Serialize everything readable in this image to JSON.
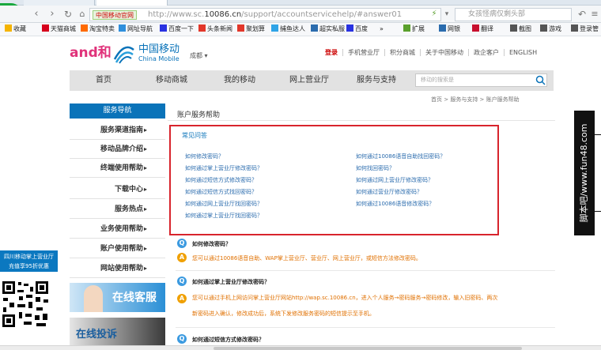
{
  "browser": {
    "site_badge": "中国移动官网",
    "url_host_prefix": "http://www.sc.",
    "url_host_main": "10086.cn",
    "url_path": "/support/accountservicehelp/#answer01",
    "search_text": "女孩怪病仅剩头部",
    "bookmarks": [
      {
        "label": "收藏",
        "icon": "star-icon",
        "color": "#f5b400"
      },
      {
        "label": "天猫商城",
        "icon": "tmall-icon",
        "color": "#d6001c"
      },
      {
        "label": "淘宝特卖",
        "icon": "taobao-icon",
        "color": "#ff6a00"
      },
      {
        "label": "网址导航",
        "icon": "nav-icon",
        "color": "#2f8fdc"
      },
      {
        "label": "百度一下",
        "icon": "baidu-icon",
        "color": "#2932e1"
      },
      {
        "label": "头条新闻",
        "icon": "news-icon",
        "color": "#e2372a"
      },
      {
        "label": "聚划算",
        "icon": "juhuasuan-icon",
        "color": "#e2372a"
      },
      {
        "label": "捕鱼达人",
        "icon": "fish-icon",
        "color": "#2fa4e7"
      },
      {
        "label": "超实私服",
        "icon": "game-icon",
        "color": "#2b6cae"
      },
      {
        "label": "百度",
        "icon": "baidu-icon",
        "color": "#2932e1"
      },
      {
        "label": "扩展",
        "icon": "extension-icon",
        "color": "#5aa02c"
      },
      {
        "label": "网银",
        "icon": "bank-icon",
        "color": "#2b6cae"
      },
      {
        "label": "翻译",
        "icon": "translate-icon",
        "color": "#c8102e"
      },
      {
        "label": "截图",
        "icon": "scissors-icon",
        "color": "#555555"
      },
      {
        "label": "游戏",
        "icon": "gamepad-icon",
        "color": "#555555"
      },
      {
        "label": "登录管",
        "icon": "user-icon",
        "color": "#555555"
      }
    ],
    "bookmark_more": "»"
  },
  "header": {
    "and_logo": "and和",
    "brand_cn": "中国移动",
    "brand_en": "China Mobile",
    "city": "成都",
    "top_links": [
      "登录",
      "手机营业厅",
      "积分商城",
      "关于中国移动",
      "政企客户",
      "ENGLISH"
    ]
  },
  "nav": {
    "items": [
      "首页",
      "移动商城",
      "我的移动",
      "网上营业厅",
      "服务与支持"
    ],
    "search_placeholder": "移动的搜索是"
  },
  "breadcrumb": "首页 > 服务与支持 > 账户服务帮助",
  "sidebar": {
    "title": "服务导航",
    "items": [
      "服务渠道指南",
      "移动品牌介绍",
      "终端使用帮助",
      "下载中心",
      "服务热点",
      "业务使用帮助",
      "账户使用帮助",
      "网站使用帮助"
    ],
    "ad_online": "在线客服",
    "ad_complaint": "在线投诉"
  },
  "float_ad": {
    "line1": "四川移动掌上营业厅",
    "line2": "充值享95折优惠"
  },
  "content": {
    "title": "账户服务帮助",
    "faq_title": "常见问答",
    "faq_left": [
      "如何修改密码？",
      "如何通过掌上营业厅修改密码？",
      "如何通过短信方式修改密码？",
      "如何通过短信方式找回密码？",
      "如何通过网上营业厅找回密码？",
      "如何通过掌上营业厅找回密码？"
    ],
    "faq_right": [
      "如何通过10086语音自助找回密码？",
      "如何找回密码？",
      "如何通过网上营业厅修改密码？",
      "如何通过营业厅修改密码？",
      "如何通过10086语音修改密码？"
    ],
    "answers": [
      {
        "q": "如何修改密码？",
        "a": [
          "您可以通过10086语音自助、WAP掌上营业厅、营业厅、网上营业厅，或短信方法修改密码。"
        ]
      },
      {
        "q": "如何通过掌上营业厅修改密码？",
        "a": [
          "您可以通过手机上网访问掌上营业厅网站http://wap.sc.10086.cn，进入个人服务→密码服务→密码修改，输入旧密码、两次",
          "新密码进入确认，修改成功后，系统下发修改服务密码的短信提示至手机。"
        ]
      },
      {
        "q": "如何通过短信方式修改密码？",
        "a": []
      }
    ]
  },
  "watermark": "脚本吧/www.fun48.com"
}
